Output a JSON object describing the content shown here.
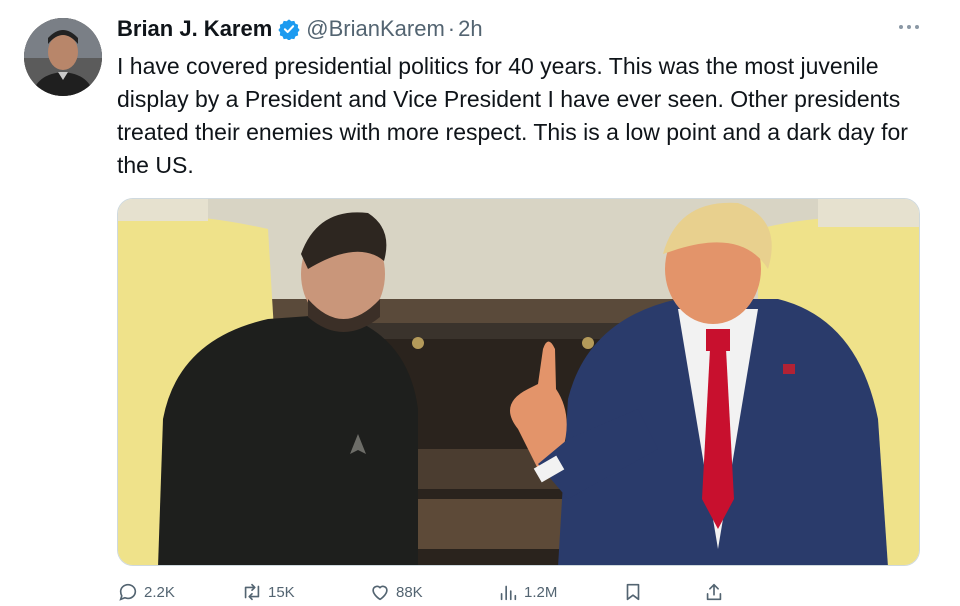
{
  "tweet": {
    "author": {
      "display_name": "Brian J. Karem",
      "handle": "@BrianKarem",
      "verified": true,
      "avatar_icon": "profile-photo"
    },
    "separator": "·",
    "timestamp": "2h",
    "text": "I have covered presidential politics for 40 years. This was the most juvenile display by a President and Vice President I have ever seen. Other presidents treated their enemies with more respect. This is a low point and a dark day for the US.",
    "media": {
      "type": "photo",
      "icon": "photo-image"
    }
  },
  "actions": {
    "reply": {
      "icon": "reply-icon",
      "count": "2.2K"
    },
    "retweet": {
      "icon": "retweet-icon",
      "count": "15K"
    },
    "like": {
      "icon": "heart-icon",
      "count": "88K"
    },
    "views": {
      "icon": "views-icon",
      "count": "1.2M"
    },
    "bookmark": {
      "icon": "bookmark-icon"
    },
    "share": {
      "icon": "share-icon"
    }
  },
  "colors": {
    "text": "#0f1419",
    "secondary": "#536471",
    "verified_blue": "#1d9bf0"
  }
}
